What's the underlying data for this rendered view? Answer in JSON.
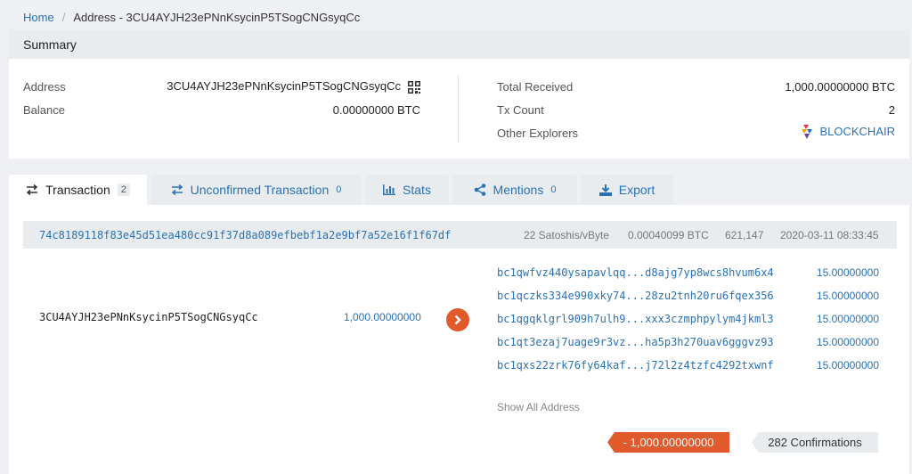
{
  "breadcrumb": {
    "home": "Home",
    "separator": "/",
    "current": "Address - 3CU4AYJH23ePNnKsycinP5TSogCNGsyqCc"
  },
  "summary": {
    "title": "Summary",
    "address_label": "Address",
    "address_value": "3CU4AYJH23ePNnKsycinP5TSogCNGsyqCc",
    "balance_label": "Balance",
    "balance_value": "0.00000000 BTC",
    "total_received_label": "Total Received",
    "total_received_value": "1,000.00000000 BTC",
    "tx_count_label": "Tx Count",
    "tx_count_value": "2",
    "other_explorers_label": "Other Explorers",
    "explorer_link": "BLOCKCHAIR"
  },
  "tabs": [
    {
      "label": "Transaction",
      "count": "2",
      "icon": "arrows-exchange-icon"
    },
    {
      "label": "Unconfirmed Transaction",
      "count": "0",
      "icon": "arrows-exchange-icon"
    },
    {
      "label": "Stats",
      "count": "",
      "icon": "bar-chart-icon"
    },
    {
      "label": "Mentions",
      "count": "0",
      "icon": "share-icon"
    },
    {
      "label": "Export",
      "count": "",
      "icon": "download-icon"
    }
  ],
  "transaction": {
    "hash": "74c8189118f83e45d51ea480cc91f37d8a089efbebf1a2e9bf7a52e16f1f67df",
    "fee_rate": "22 Satoshis/vByte",
    "fee": "0.00040099 BTC",
    "block": "621,147",
    "time": "2020-03-11 08:33:45",
    "input": {
      "address": "3CU4AYJH23ePNnKsycinP5TSogCNGsyqCc",
      "amount": "1,000.00000000"
    },
    "outputs": [
      {
        "address": "bc1qwfvz440ysapavlqq...d8ajg7yp8wcs8hvum6x4",
        "amount": "15.00000000"
      },
      {
        "address": "bc1qczks334e990xky74...28zu2tnh20ru6fqex356",
        "amount": "15.00000000"
      },
      {
        "address": "bc1qgqklgrl909h7ulh9...xxx3czmphpylym4jkml3",
        "amount": "15.00000000"
      },
      {
        "address": "bc1qt3ezaj7uage9r3vz...ha5p3h270uav6gggvz93",
        "amount": "15.00000000"
      },
      {
        "address": "bc1qxs22zrk76fy64kaf...j72l2z4tzfc4292txwnf",
        "amount": "15.00000000"
      }
    ],
    "show_all": "Show All Address",
    "net_amount": "- 1,000.00000000",
    "confirmations": "282 Confirmations"
  },
  "colors": {
    "link": "#2a72b5",
    "accent": "#e05a2b",
    "header_bg": "#e9ecef",
    "page_bg": "#eef0f3"
  }
}
